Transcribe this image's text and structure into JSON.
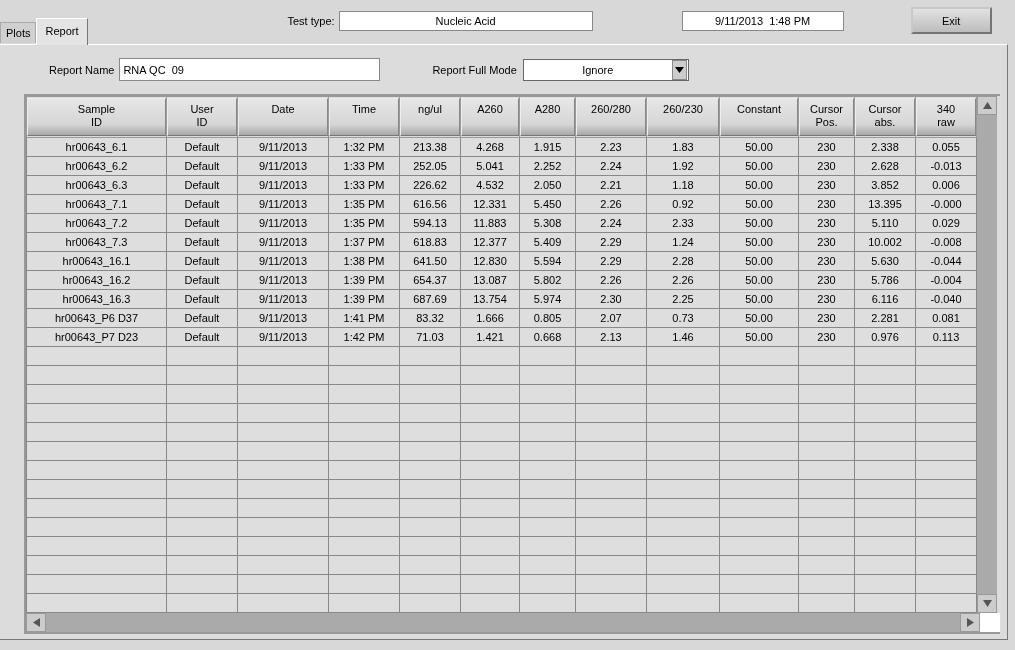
{
  "tabs": [
    {
      "label": "Plots",
      "selected": false
    },
    {
      "label": "Report",
      "selected": true
    }
  ],
  "test_type": {
    "label": "Test type:",
    "value": "Nucleic Acid"
  },
  "timestamp": "9/11/2013  1:48 PM",
  "exit_button": "Exit",
  "report_name": {
    "label": "Report Name",
    "value": "RNA QC  09"
  },
  "report_mode": {
    "label": "Report Full Mode",
    "value": "Ignore"
  },
  "table": {
    "columns": [
      "Sample\nID",
      "User\nID",
      "Date",
      "Time",
      "ng/ul",
      "A260",
      "A280",
      "260/280",
      "260/230",
      "Constant",
      "Cursor\nPos.",
      "Cursor\nabs.",
      "340\nraw"
    ],
    "rows": [
      [
        "hr00643_6.1",
        "Default",
        "9/11/2013",
        "1:32 PM",
        "213.38",
        "4.268",
        "1.915",
        "2.23",
        "1.83",
        "50.00",
        "230",
        "2.338",
        "0.055"
      ],
      [
        "hr00643_6.2",
        "Default",
        "9/11/2013",
        "1:33 PM",
        "252.05",
        "5.041",
        "2.252",
        "2.24",
        "1.92",
        "50.00",
        "230",
        "2.628",
        "-0.013"
      ],
      [
        "hr00643_6.3",
        "Default",
        "9/11/2013",
        "1:33 PM",
        "226.62",
        "4.532",
        "2.050",
        "2.21",
        "1.18",
        "50.00",
        "230",
        "3.852",
        "0.006"
      ],
      [
        "hr00643_7.1",
        "Default",
        "9/11/2013",
        "1:35 PM",
        "616.56",
        "12.331",
        "5.450",
        "2.26",
        "0.92",
        "50.00",
        "230",
        "13.395",
        "-0.000"
      ],
      [
        "hr00643_7.2",
        "Default",
        "9/11/2013",
        "1:35 PM",
        "594.13",
        "11.883",
        "5.308",
        "2.24",
        "2.33",
        "50.00",
        "230",
        "5.110",
        "0.029"
      ],
      [
        "hr00643_7.3",
        "Default",
        "9/11/2013",
        "1:37 PM",
        "618.83",
        "12.377",
        "5.409",
        "2.29",
        "1.24",
        "50.00",
        "230",
        "10.002",
        "-0.008"
      ],
      [
        "hr00643_16.1",
        "Default",
        "9/11/2013",
        "1:38 PM",
        "641.50",
        "12.830",
        "5.594",
        "2.29",
        "2.28",
        "50.00",
        "230",
        "5.630",
        "-0.044"
      ],
      [
        "hr00643_16.2",
        "Default",
        "9/11/2013",
        "1:39 PM",
        "654.37",
        "13.087",
        "5.802",
        "2.26",
        "2.26",
        "50.00",
        "230",
        "5.786",
        "-0.004"
      ],
      [
        "hr00643_16.3",
        "Default",
        "9/11/2013",
        "1:39 PM",
        "687.69",
        "13.754",
        "5.974",
        "2.30",
        "2.25",
        "50.00",
        "230",
        "6.116",
        "-0.040"
      ],
      [
        "hr00643_P6 D37",
        "Default",
        "9/11/2013",
        "1:41 PM",
        "83.32",
        "1.666",
        "0.805",
        "2.07",
        "0.73",
        "50.00",
        "230",
        "2.281",
        "0.081"
      ],
      [
        "hr00643_P7 D23",
        "Default",
        "9/11/2013",
        "1:42 PM",
        "71.03",
        "1.421",
        "0.668",
        "2.13",
        "1.46",
        "50.00",
        "230",
        "0.976",
        "0.113"
      ]
    ]
  }
}
